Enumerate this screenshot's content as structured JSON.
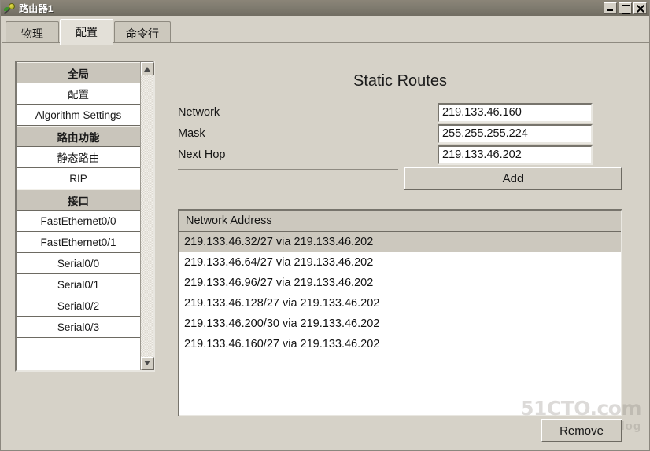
{
  "window": {
    "title": "路由器1",
    "icon": "router-device-icon",
    "controls": {
      "minimize": "minimize-button",
      "maximize": "maximize-button",
      "close": "close-button"
    }
  },
  "tabs": [
    {
      "label": "物理",
      "active": false
    },
    {
      "label": "配置",
      "active": true
    },
    {
      "label": "命令行",
      "active": false
    }
  ],
  "sidebar": {
    "items": [
      {
        "label": "全局",
        "type": "group"
      },
      {
        "label": "配置",
        "type": "item"
      },
      {
        "label": "Algorithm Settings",
        "type": "item"
      },
      {
        "label": "路由功能",
        "type": "group"
      },
      {
        "label": "静态路由",
        "type": "item"
      },
      {
        "label": "RIP",
        "type": "item"
      },
      {
        "label": "接口",
        "type": "group"
      },
      {
        "label": "FastEthernet0/0",
        "type": "item"
      },
      {
        "label": "FastEthernet0/1",
        "type": "item"
      },
      {
        "label": "Serial0/0",
        "type": "item"
      },
      {
        "label": "Serial0/1",
        "type": "item"
      },
      {
        "label": "Serial0/2",
        "type": "item"
      },
      {
        "label": "Serial0/3",
        "type": "item"
      },
      {
        "label": "",
        "type": "blank"
      },
      {
        "label": "",
        "type": "blank"
      }
    ],
    "scrollbar": {
      "up_arrow": "scroll-up-arrow",
      "down_arrow": "scroll-down-arrow"
    }
  },
  "main": {
    "panel_title": "Static Routes",
    "fields": {
      "network": {
        "label": "Network",
        "value": "219.133.46.160",
        "placeholder": ""
      },
      "mask": {
        "label": "Mask",
        "value": "255.255.255.224",
        "placeholder": ""
      },
      "next_hop": {
        "label": "Next Hop",
        "value": "219.133.46.202",
        "placeholder": ""
      }
    },
    "add_button": "Add",
    "remove_button": "Remove",
    "routes_table": {
      "column_header": "Network Address",
      "rows": [
        {
          "text": "219.133.46.32/27 via 219.133.46.202",
          "selected": true
        },
        {
          "text": "219.133.46.64/27 via 219.133.46.202",
          "selected": false
        },
        {
          "text": "219.133.46.96/27 via 219.133.46.202",
          "selected": false
        },
        {
          "text": "219.133.46.128/27 via 219.133.46.202",
          "selected": false
        },
        {
          "text": "219.133.46.200/30 via 219.133.46.202",
          "selected": false
        },
        {
          "text": "219.133.46.160/27 via 219.133.46.202",
          "selected": false
        }
      ]
    }
  },
  "watermark": {
    "main": "51CTO.com",
    "sub": "Blog"
  },
  "colors": {
    "window_bg": "#d6d2c8",
    "titlebar": "#7e7a6e",
    "active_tab": "#e3e0d8",
    "group_header": "#c9c5bb",
    "selection": "#ccc8be",
    "field_bg": "#ffffff",
    "border_dark": "#77746c"
  }
}
